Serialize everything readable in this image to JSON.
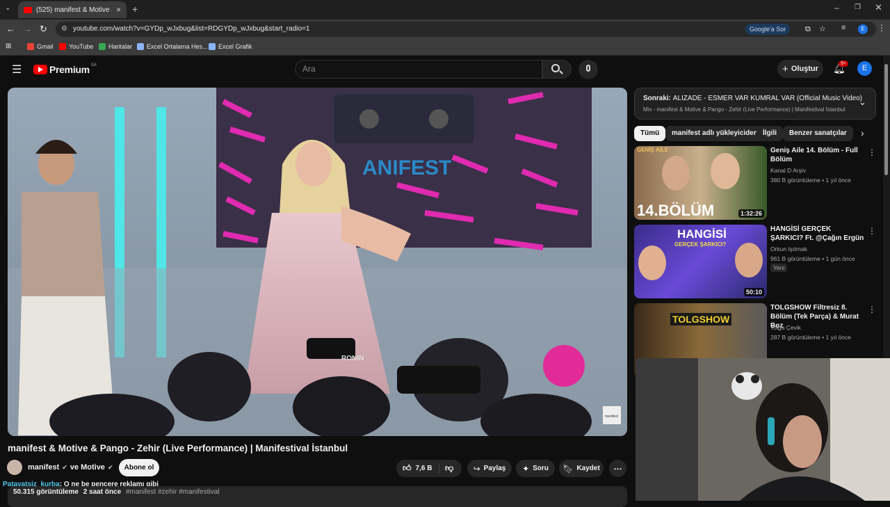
{
  "browser": {
    "tab_title": "(525) manifest & Motive & Pango - Zehir (Live Performance) | Manifestival İstanbul",
    "url": "youtube.com/watch?v=GYDp_wJxbug&list=RDGYDp_wJxbug&start_radio=1",
    "google_label": "Google'a Sor",
    "profile_letter": "E",
    "bookmarks": [
      "Gmail",
      "YouTube",
      "Haritalar",
      "Excel Ortalama Hes...",
      "Excel Grafik"
    ]
  },
  "header": {
    "logo_text": "Premium",
    "region_code": "SA",
    "search_placeholder": "Ara",
    "create_label": "Oluştur",
    "notification_count": "9+",
    "avatar_letter": "E"
  },
  "video": {
    "title": "manifest & Motive & Pango - Zehir (Live Performance) | Manifestival İstanbul",
    "watermark": "manifest",
    "screen_text": "ANIFEST",
    "camera_brand": "RONIN"
  },
  "channel": {
    "name": "manifest",
    "collab": "ve Motive",
    "subscribe_label": "Abone ol",
    "likes": "7,6 B",
    "share_label": "Paylaş",
    "ask_label": "Soru",
    "save_label": "Kaydet"
  },
  "chat": {
    "user": "Patavatsiz_kurba",
    "message": ": O ne be pencere reklamı gibi"
  },
  "description": {
    "views": "50.315 görüntüleme",
    "time": "2 saat önce",
    "tags": "#manifest #zehir #manifestival"
  },
  "sidebar": {
    "next_label": "Sonraki:",
    "next_title": "ALIZADE - ESMER VAR KUMRAL VAR (Official Music Video)",
    "mix_subtitle": "Mix - manifest & Motive & Pango - Zehir (Live Performance) | Manifestival İstanbul",
    "chips": [
      "Tümü",
      "manifest adlı yükleyiciden",
      "İlgili",
      "Benzer sanatçılar"
    ],
    "items": [
      {
        "title": "Geniş Aile 14. Bölüm - Full Bölüm",
        "channel": "Kanal D Arşiv",
        "meta": "380 B görüntüleme • 1 yıl önce",
        "duration": "1:32:26",
        "overlay": "14.BÖLÜM",
        "badge": "GENİŞ AİLE"
      },
      {
        "title": "HANGİSİ GERÇEK ŞARKICI? Ft. @Çağın Ergün",
        "channel": "Orkun Işıtmak",
        "meta": "961 B görüntüleme • 1 gün önce",
        "tag": "Yeni",
        "duration": "50:10",
        "overlay": "HANGİSİ",
        "overlay2": "GERÇEK ŞARKICI?"
      },
      {
        "title": "TOLGSHOW Filtresiz 8. Bölüm (Tek Parça) & Murat Boz",
        "channel": "Tolga Çevik",
        "meta": "287 B görüntüleme • 1 yıl önce",
        "overlay": "TOLGSHOW"
      }
    ]
  }
}
